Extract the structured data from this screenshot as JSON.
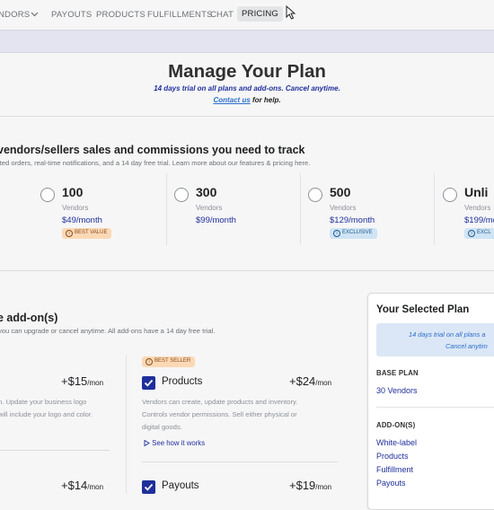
{
  "nav": {
    "items": [
      "NDORS",
      "PAYOUTS",
      "PRODUCTS",
      "FULFILLMENTS",
      "CHAT",
      "PRICING"
    ],
    "active": "PRICING"
  },
  "header": {
    "title": "Manage Your Plan",
    "subtitle": "14 days trial on all plans and add-ons. Cancel anytime.",
    "help_link": "Contact us",
    "help_suffix": " for help."
  },
  "plans_section": {
    "title": "vendors/sellers sales and commissions you need to track",
    "description": "ited orders, real-time notifications, and a 14 day free trial. Learn more about our features & pricing here.",
    "plans": [
      {
        "count": "100",
        "label": "Vendors",
        "price": "$49/month",
        "badge": "BEST VALUE",
        "badge_style": "orange"
      },
      {
        "count": "300",
        "label": "Vendors",
        "price": "$99/month",
        "badge": "",
        "badge_style": ""
      },
      {
        "count": "500",
        "label": "Vendors",
        "price": "$129/month",
        "badge": "EXCLUSIVE",
        "badge_style": "blue"
      },
      {
        "count": "Unli",
        "label": "Vendors",
        "price": "$199/mo",
        "badge": "EXCL",
        "badge_style": "blue"
      }
    ]
  },
  "addons_section": {
    "title": "e add-on(s)",
    "description": "you can upgrade or cancel anytime. All add-ons have a 14 day free trial.",
    "left_card": {
      "price": "+$15",
      "period": "/mon",
      "desc_line1": "n. Update your business logo",
      "desc_line2": "will include your logo and color."
    },
    "products_card": {
      "badge": "BEST SELLER",
      "name": "Products",
      "price": "+$24",
      "period": "/mon",
      "desc_line1": "Vendors can create, update products and inventory.",
      "desc_line2": "Controls vendor permissions. Sell either physical or",
      "desc_line3": "digital goods.",
      "see_link": "See how it works"
    },
    "left_card2": {
      "price": "+$14",
      "period": "/mon"
    },
    "payouts_card": {
      "name": "Payouts",
      "price": "+$19",
      "period": "/mon"
    }
  },
  "selected_plan": {
    "title": "Your Selected Plan",
    "trial_line1": "14 days trial on all plans a",
    "trial_line2": "Cancel anytim",
    "base_plan_label": "BASE PLAN",
    "base_plan_value": "30 Vendors",
    "addons_label": "ADD-ON(S)",
    "addons": [
      "White-label",
      "Products",
      "Fulfillment",
      "Payouts"
    ]
  },
  "colors": {
    "accent": "#1f2f9a",
    "link": "#2c6ecb",
    "badge_orange": "#fcd9b6",
    "badge_blue": "#cfe4f5"
  }
}
